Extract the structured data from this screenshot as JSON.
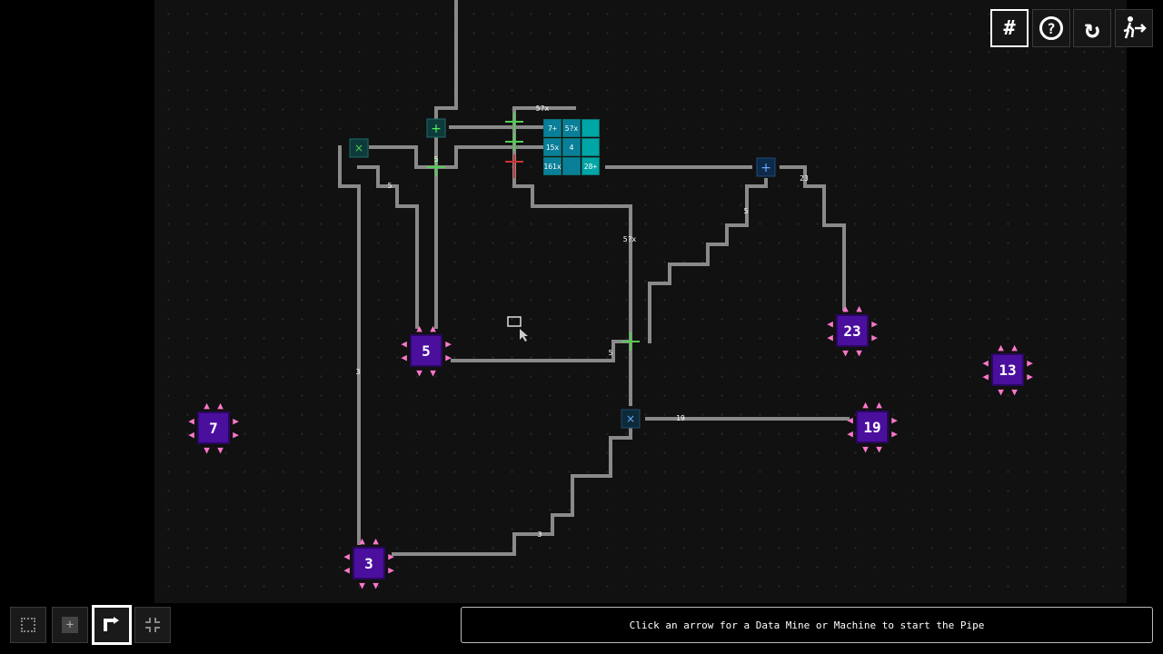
{
  "toolbar": {
    "grid_label": "#",
    "help_label": "?",
    "restart_label": "↻",
    "exit_label": "exit-icon"
  },
  "tools": [
    {
      "name": "select-tool",
      "icon": "dotted-square-icon"
    },
    {
      "name": "place-tool",
      "icon": "plus-square-icon"
    },
    {
      "name": "pipe-tool",
      "icon": "pipe-arrow-icon"
    },
    {
      "name": "move-tool",
      "icon": "crosshair-corners-icon"
    }
  ],
  "hint": {
    "text": "Click an arrow for a Data Mine or Machine to start the Pipe"
  },
  "nodes": [
    {
      "label": "5"
    },
    {
      "label": "23"
    },
    {
      "label": "13"
    },
    {
      "label": "7"
    },
    {
      "label": "19"
    },
    {
      "label": "3"
    }
  ],
  "grid_cells": [
    "7+",
    "5?x",
    "",
    "15x",
    "4",
    "",
    "161x",
    "",
    "28+"
  ],
  "pipe_labels": [
    "5?x",
    "5",
    "5",
    "23",
    "5?x",
    "5",
    "5",
    "3",
    "19",
    "3"
  ],
  "colors": {
    "node": "#4b0f9e",
    "arrow": "#ff77cc",
    "pipe": "#8a8a8a",
    "machine": "#00a6a6",
    "junction": "#55cc55"
  }
}
